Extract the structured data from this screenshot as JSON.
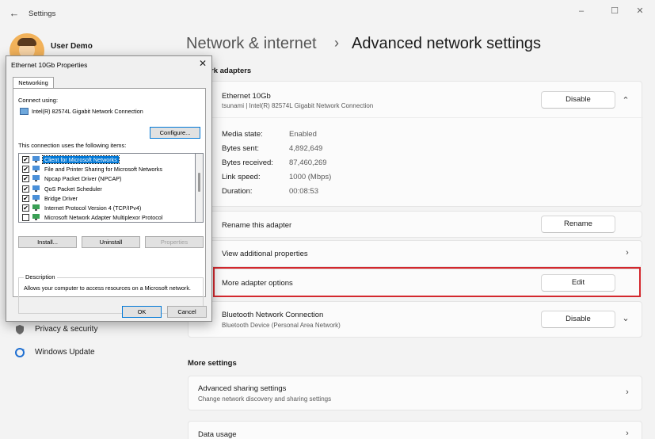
{
  "window": {
    "app_title": "Settings",
    "back_glyph": "←",
    "minimize_glyph": "–",
    "maximize_glyph": "☐",
    "close_glyph": "✕"
  },
  "user": {
    "name": "User Demo"
  },
  "breadcrumb": {
    "parent": "Network & internet",
    "separator": "›",
    "current": "Advanced network settings"
  },
  "sections": {
    "adapters_partial": "rk adapters",
    "more_settings": "More settings"
  },
  "ethernet": {
    "name": "Ethernet 10Gb",
    "subtitle": "tsunami | Intel(R) 82574L Gigabit Network Connection",
    "disable_label": "Disable",
    "chevron": "⌃",
    "properties": [
      {
        "key": "Media state:",
        "value": "Enabled"
      },
      {
        "key": "Bytes sent:",
        "value": "4,892,649"
      },
      {
        "key": "Bytes received:",
        "value": "87,460,269"
      },
      {
        "key": "Link speed:",
        "value": "1000 (Mbps)"
      },
      {
        "key": "Duration:",
        "value": "00:08:53"
      }
    ]
  },
  "rename": {
    "title": "Rename this adapter",
    "button": "Rename"
  },
  "additional": {
    "title": "View additional properties",
    "chevron": "›"
  },
  "more_options": {
    "title": "More adapter options",
    "button": "Edit"
  },
  "bluetooth": {
    "name": "Bluetooth Network Connection",
    "subtitle": "Bluetooth Device (Personal Area Network)",
    "disable_label": "Disable",
    "chevron": "⌄"
  },
  "sharing": {
    "title": "Advanced sharing settings",
    "subtitle": "Change network discovery and sharing settings",
    "chevron": "›"
  },
  "data_usage": {
    "title": "Data usage",
    "chevron": "›"
  },
  "nav": {
    "privacy": "Privacy & security",
    "windows_update": "Windows Update"
  },
  "dialog": {
    "title": "Ethernet 10Gb Properties",
    "close_glyph": "✕",
    "tab": "Networking",
    "connect_using_label": "Connect using:",
    "adapter_name": "Intel(R) 82574L Gigabit Network Connection",
    "configure_label": "Configure...",
    "items_label": "This connection uses the following items:",
    "items": [
      {
        "label": "Client for Microsoft Networks",
        "checked": "✔",
        "selected": true,
        "icon_color": "#4a90d9"
      },
      {
        "label": "File and Printer Sharing for Microsoft Networks",
        "checked": "✔",
        "selected": false,
        "icon_color": "#4a90d9"
      },
      {
        "label": "Npcap Packet Driver (NPCAP)",
        "checked": "✔",
        "selected": false,
        "icon_color": "#4a90d9"
      },
      {
        "label": "QoS Packet Scheduler",
        "checked": "✔",
        "selected": false,
        "icon_color": "#4a90d9"
      },
      {
        "label": "Bridge Driver",
        "checked": "✔",
        "selected": false,
        "icon_color": "#4a90d9"
      },
      {
        "label": "Internet Protocol Version 4 (TCP/IPv4)",
        "checked": "✔",
        "selected": false,
        "icon_color": "#3aa055"
      },
      {
        "label": "Microsoft Network Adapter Multiplexor Protocol",
        "checked": "",
        "selected": false,
        "icon_color": "#3aa055"
      }
    ],
    "install_label": "Install...",
    "uninstall_label": "Uninstall",
    "properties_label": "Properties",
    "description_legend": "Description",
    "description_text": "Allows your computer to access resources on a Microsoft network.",
    "ok_label": "OK",
    "cancel_label": "Cancel"
  },
  "colors": {
    "highlight": "#d3282e",
    "selection": "#0078d7"
  }
}
